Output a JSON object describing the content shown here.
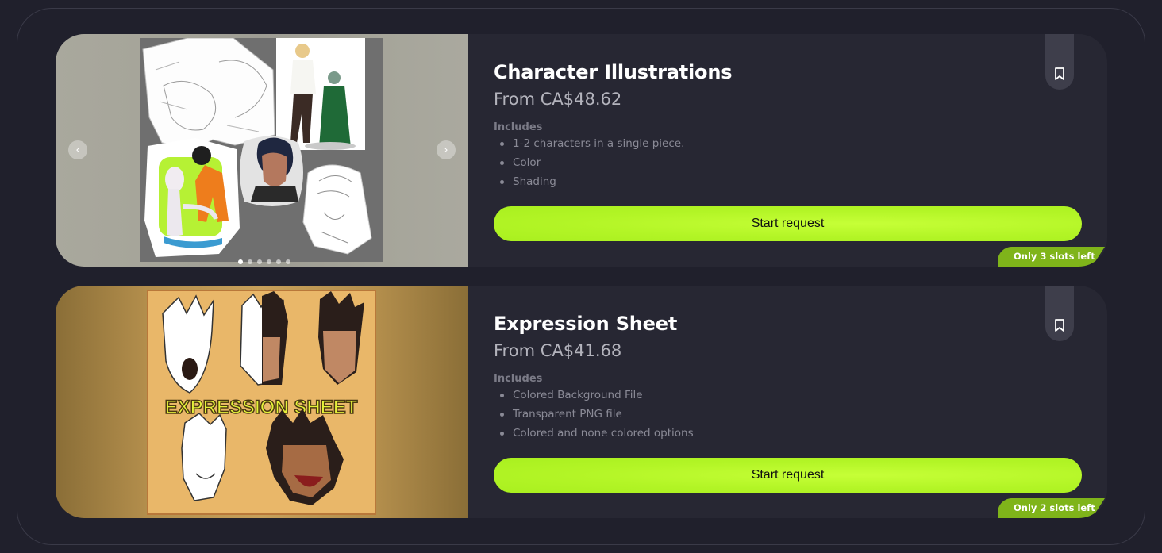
{
  "offers": [
    {
      "title": "Character Illustrations",
      "price": "From CA$48.62",
      "includes_label": "Includes",
      "includes": [
        "1-2 characters in a single piece.",
        "Color",
        "Shading"
      ],
      "cta_label": "Start request",
      "slots_badge": "Only 3 slots left",
      "image_subject": "Sheet of character illustrations: a winged gargoyle sketch, a blond man and a green-skinned woman, an anime fighter leaning over a white alien creature, an elf portrait and a curly-haired line-art portrait",
      "gallery": {
        "prev": "‹",
        "next": "›",
        "slide_count": 6,
        "active_slide": 1
      },
      "icons": {
        "bookmark": "bookmark-icon",
        "prev": "chevron-left-icon",
        "next": "chevron-right-icon"
      }
    },
    {
      "title": "Expression Sheet",
      "price": "From CA$41.68",
      "includes_label": "Includes",
      "includes": [
        "Colored Background File",
        "Transparent PNG file",
        "Colored and none colored options"
      ],
      "cta_label": "Start request",
      "slots_badge": "Only 2 slots left",
      "image_subject": "Expression sheet of a spiky-haired elf man shown shouting, smirking, worried and in werewolf form",
      "image_text": "EXPRESSION SHEET",
      "icons": {
        "bookmark": "bookmark-icon"
      }
    }
  ],
  "colors": {
    "page_bg": "#20202c",
    "card_bg": "#272733",
    "accent": "#b3f526",
    "badge": "#7fb41a",
    "muted_text": "#8a8a96"
  }
}
